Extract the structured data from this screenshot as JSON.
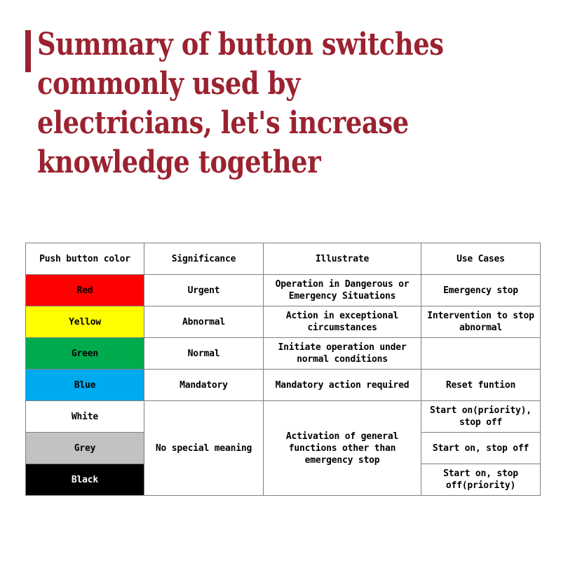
{
  "title": {
    "text": "Summary of button switches commonly used by electricians, let's increase knowledge together",
    "color": "#9b2230",
    "accent_bar_color": "#9b2230"
  },
  "table": {
    "headers": [
      "Push button color",
      "Significance",
      "Illustrate",
      "Use Cases"
    ],
    "rows": [
      {
        "color_label": "Red",
        "swatch_hex": "#fe0000",
        "significance": "Urgent",
        "illustrate": "Operation in Dangerous or Emergency Situations",
        "use_cases": "Emergency stop"
      },
      {
        "color_label": "Yellow",
        "swatch_hex": "#ffff00",
        "significance": "Abnormal",
        "illustrate": "Action in exceptional circumstances",
        "use_cases": "Intervention to stop abnormal"
      },
      {
        "color_label": "Green",
        "swatch_hex": "#00ab4e",
        "significance": "Normal",
        "illustrate": "Initiate operation under normal conditions",
        "use_cases": ""
      },
      {
        "color_label": "Blue",
        "swatch_hex": "#00aaee",
        "significance": "Mandatory",
        "illustrate": "Mandatory action required",
        "use_cases": "Reset funtion"
      },
      {
        "color_label": "White",
        "swatch_hex": "#ffffff",
        "significance": "No special meaning",
        "illustrate": "Activation of general functions other than emergency stop",
        "use_cases": "Start on(priority), stop off"
      },
      {
        "color_label": "Grey",
        "swatch_hex": "#c2c2c2",
        "significance": "",
        "illustrate": "",
        "use_cases": "Start on, stop off"
      },
      {
        "color_label": "Black",
        "swatch_hex": "#000000",
        "significance": "",
        "illustrate": "",
        "use_cases": "Start on, stop off(priority)"
      }
    ],
    "merged": {
      "significance_merged_label": "No special meaning",
      "illustrate_merged_label": "Activation of general functions other than emergency stop"
    }
  }
}
